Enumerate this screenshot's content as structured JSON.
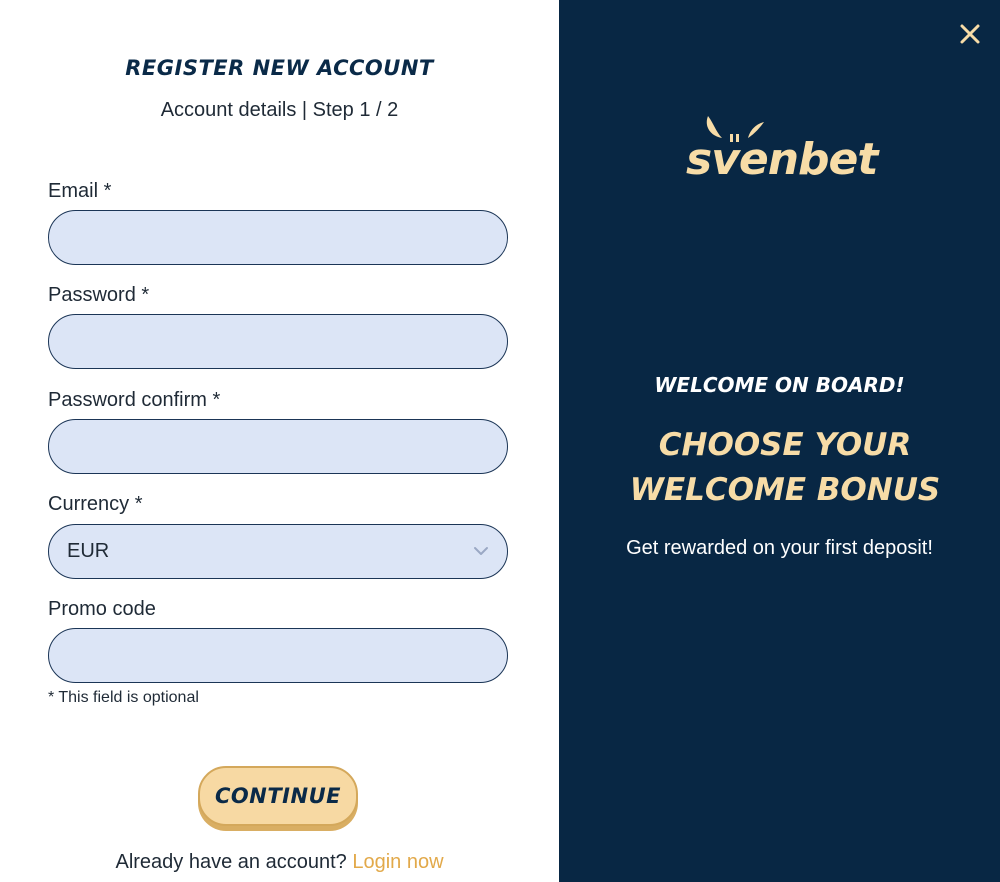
{
  "form": {
    "title": "REGISTER NEW ACCOUNT",
    "subtitle": "Account details | Step 1 / 2",
    "fields": {
      "email": {
        "label": "Email *",
        "value": ""
      },
      "password": {
        "label": "Password *",
        "value": ""
      },
      "password_confirm": {
        "label": "Password confirm *",
        "value": ""
      },
      "currency": {
        "label": "Currency *",
        "selected": "EUR"
      },
      "promo_code": {
        "label": "Promo code",
        "value": ""
      }
    },
    "optional_note": "* This field is optional",
    "continue_label": "CONTINUE",
    "login_prompt": "Already have an account?",
    "login_link": "Login now"
  },
  "promo": {
    "brand": "svenbet",
    "welcome_small": "WELCOME ON BOARD!",
    "welcome_big": "CHOOSE YOUR WELCOME BONUS",
    "welcome_sub": "Get rewarded on your first deposit!"
  },
  "icons": {
    "close": "close-icon",
    "chevron": "chevron-down-icon",
    "logo_horns": "horns-icon"
  },
  "colors": {
    "panel_bg": "#082744",
    "input_bg": "#dce5f6",
    "accent_gold": "#f7dca7",
    "link": "#e2a94a"
  }
}
